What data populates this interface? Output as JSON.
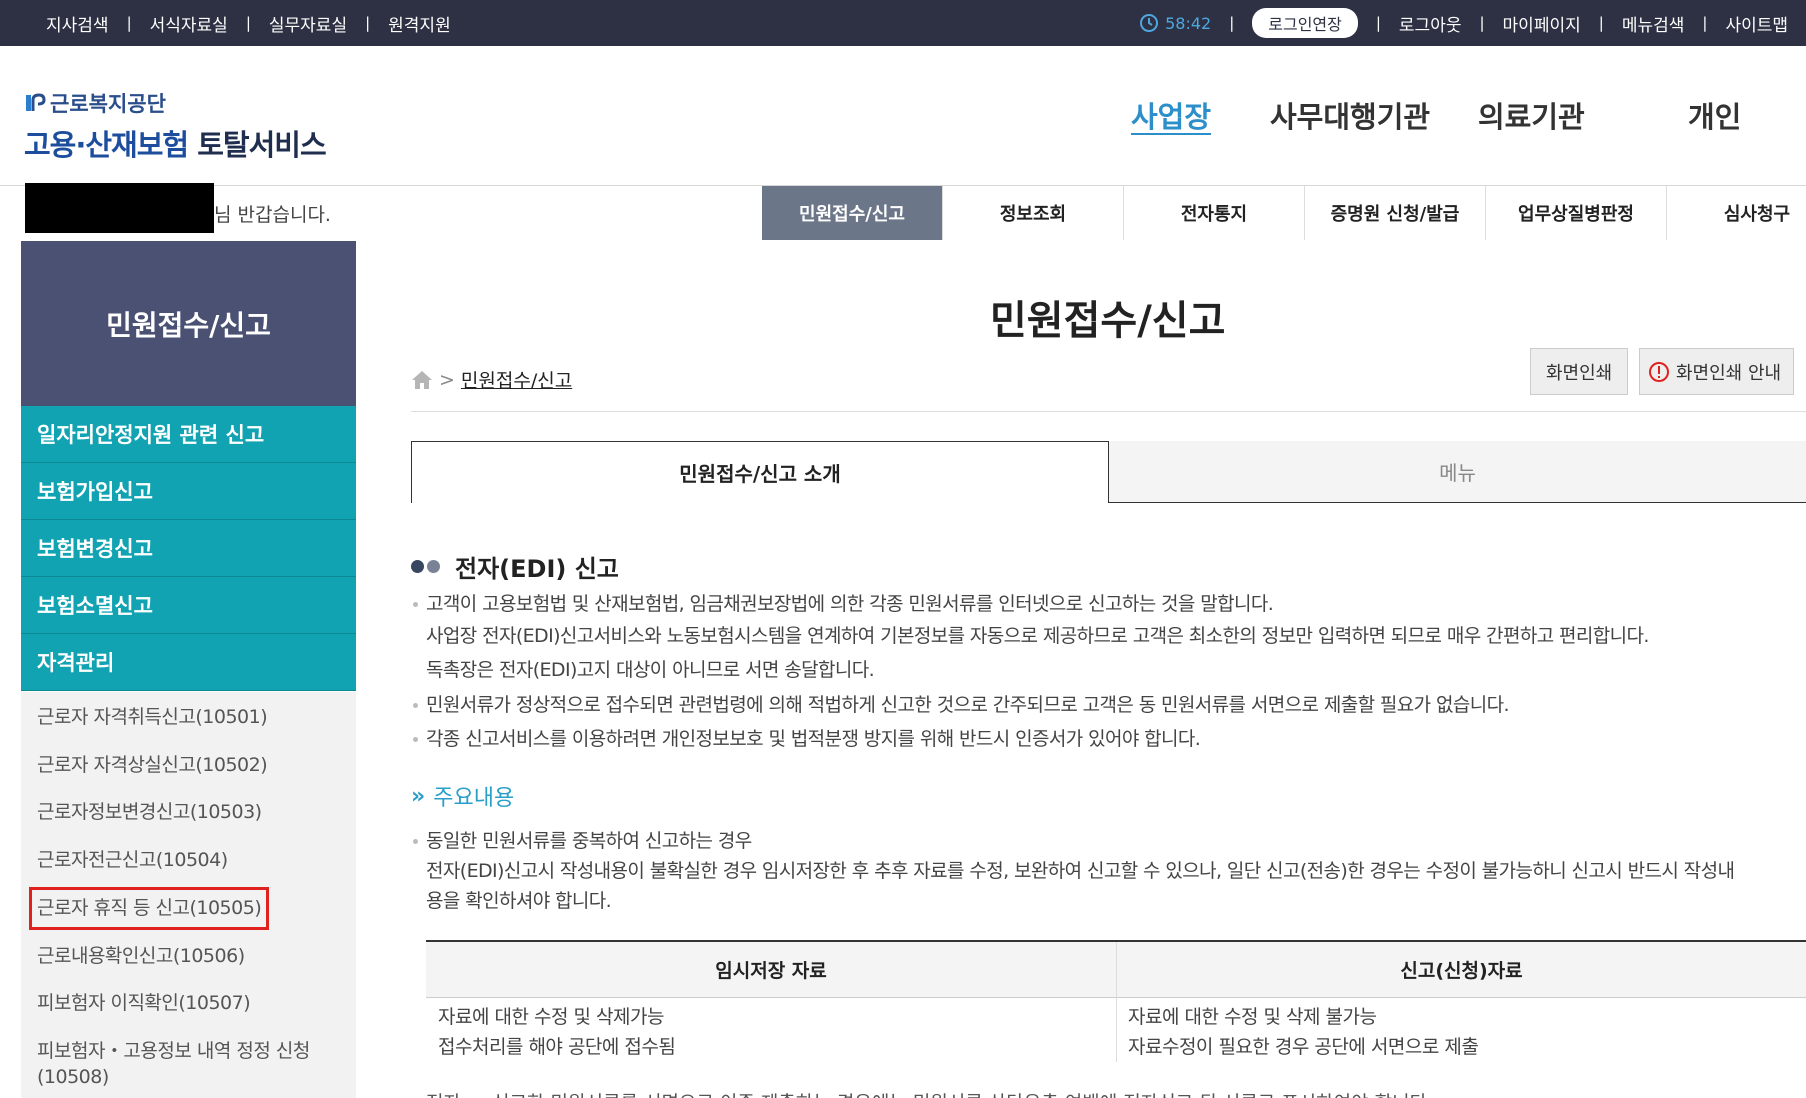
{
  "topbar": {
    "left_links": [
      "지사검색",
      "서식자료실",
      "실무자료실",
      "원격지원"
    ],
    "timer": "58:42",
    "extend_label": "로그인연장",
    "right_links": [
      "로그아웃",
      "마이페이지",
      "메뉴검색",
      "사이트맵"
    ]
  },
  "logo": {
    "org": "근로복지공단",
    "title_blue": "고용·산재보험",
    "title_dark": "토탈서비스"
  },
  "gnb": {
    "items": [
      "사업장",
      "사무대행기관",
      "의료기관",
      "개인"
    ],
    "active": "사업장"
  },
  "welcome": "님 반갑습니다.",
  "subnav": [
    "민원접수/신고",
    "정보조회",
    "전자통지",
    "증명원 신청/발급",
    "업무상질병판정",
    "심사청구"
  ],
  "sidebar": {
    "title": "민원접수/신고",
    "menu": [
      "일자리안정지원 관련 신고",
      "보험가입신고",
      "보험변경신고",
      "보험소멸신고",
      "자격관리"
    ],
    "sub_items": [
      "근로자 자격취득신고(10501)",
      "근로자 자격상실신고(10502)",
      "근로자정보변경신고(10503)",
      "근로자전근신고(10504)",
      "근로자 휴직 등 신고(10505)",
      "근로내용확인신고(10506)",
      "피보험자 이직확인(10507)",
      "피보험자・고용정보 내역 정정 신청",
      "(10508)"
    ]
  },
  "main": {
    "title": "민원접수/신고",
    "breadcrumb": "민원접수/신고",
    "print_label": "화면인쇄",
    "print_guide_label": "화면인쇄 안내",
    "tabs": [
      "민원접수/신고 소개",
      "메뉴"
    ],
    "section_title": "전자(EDI) 신고",
    "paragraphs": [
      "고객이 고용보험법 및 산재보험법, 임금채권보장법에 의한 각종 민원서류를 인터넷으로 신고하는 것을 말합니다.",
      "사업장 전자(EDI)신고서비스와 노동보험시스템을 연계하여 기본정보를 자동으로 제공하므로 고객은 최소한의 정보만 입력하면 되므로 매우 간편하고 편리합니다.",
      "독촉장은 전자(EDI)고지 대상이 아니므로 서면 송달합니다.",
      "민원서류가 정상적으로 접수되면 관련법령에 의해 적법하게 신고한 것으로 간주되므로 고객은 동 민원서류를 서면으로 제출할 필요가 없습니다.",
      "각종 신고서비스를 이용하려면 개인정보보호 및 법적분쟁 방지를 위해 반드시 인증서가 있어야 합니다."
    ],
    "sub_title": "주요내용",
    "sub_paragraphs": [
      "동일한 민원서류를 중복하여 신고하는 경우",
      "전자(EDI)신고시 작성내용이 불확실한 경우 임시저장한 후 추후 자료를 수정, 보완하여 신고할 수 있으나, 일단 신고(전송)한 경우는 수정이 불가능하니 신고시 반드시 작성내",
      "용을 확인하셔야 합니다."
    ],
    "table": {
      "headers": [
        "임시저장 자료",
        "신고(신청)자료"
      ],
      "rows": [
        [
          "자료에 대한 수정 및 삭제가능",
          "자료에 대한 수정 및 삭제 불가능"
        ],
        [
          "접수처리를 해야 공단에 접수됨",
          "자료수정이 필요한 경우 공단에 서면으로 제출"
        ]
      ]
    },
    "cut_off_text": "전자 … 신고한 민원서류를 서면으로 이중 제출하는 경우에는 민원서류 상단우측 여백에 전자신고 된 서류로 표시하여야 합니다"
  }
}
